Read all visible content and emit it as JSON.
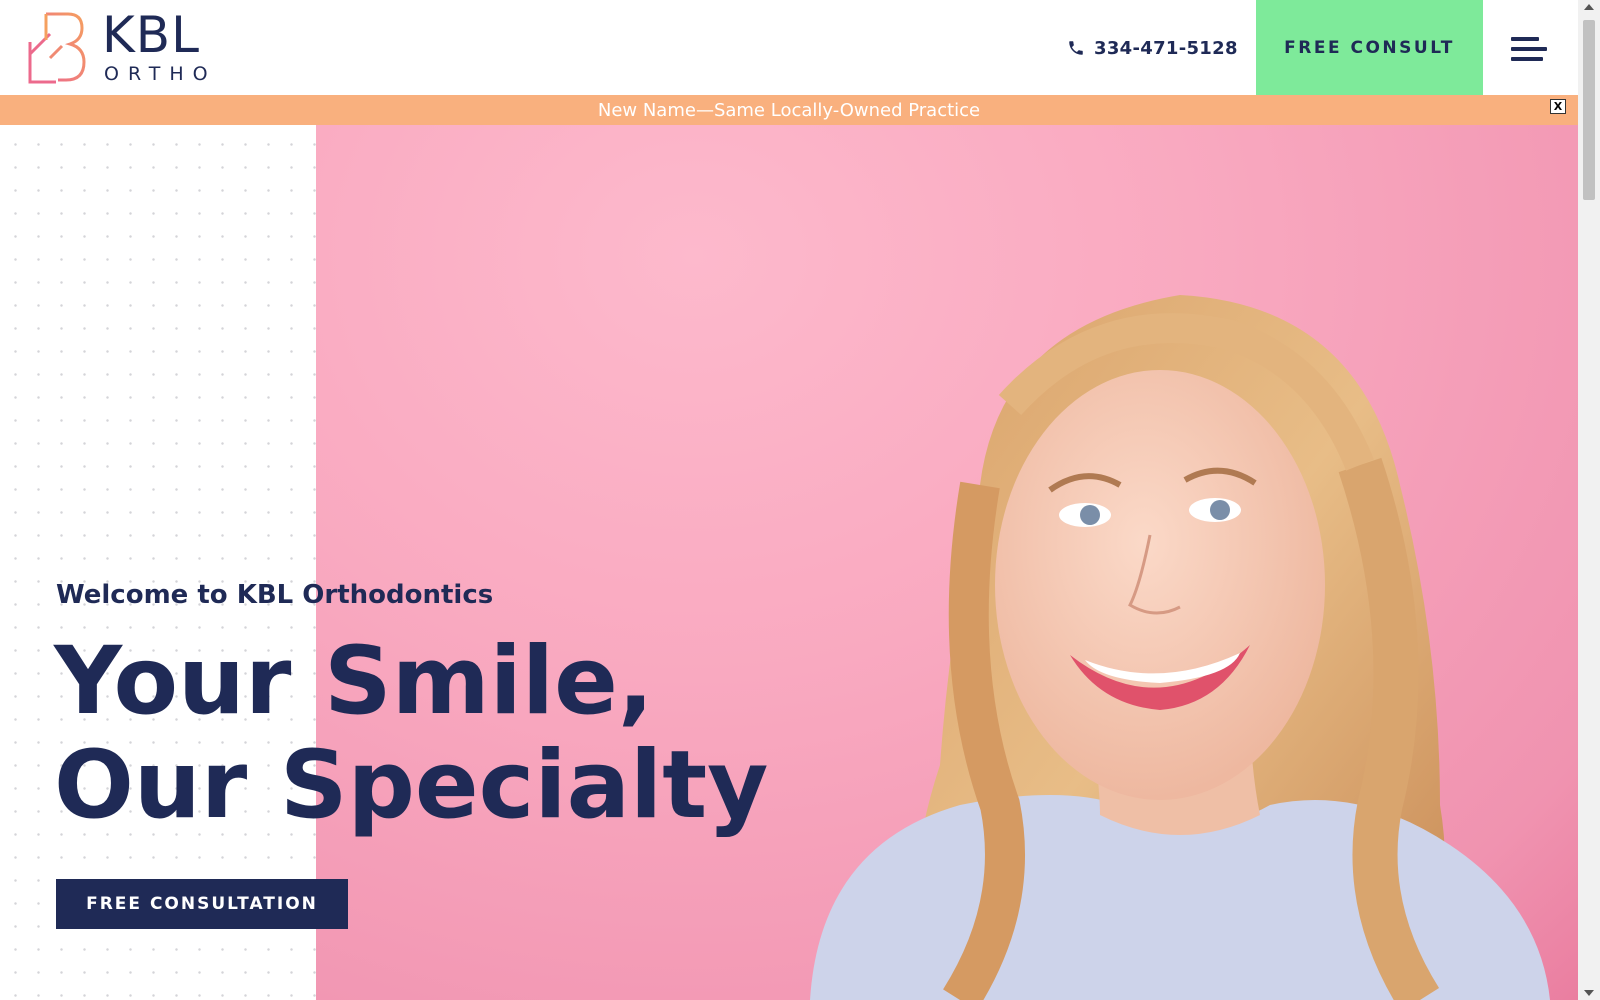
{
  "header": {
    "logo": {
      "brand": "KBL",
      "sub": "ORTHO"
    },
    "phone": {
      "icon": "phone-icon",
      "number": "334-471-5128"
    },
    "consult_button": "FREE CONSULT",
    "menu_icon": "hamburger-menu-icon"
  },
  "banner": {
    "text": "New Name—Same Locally-Owned Practice",
    "close_label": "X"
  },
  "hero": {
    "welcome": "Welcome to KBL Orthodontics",
    "headline_line1": "Your Smile,",
    "headline_line2": "Our Specialty",
    "cta_label": "FREE CONSULTATION"
  },
  "colors": {
    "navy": "#1f2a56",
    "consult_green": "#7eea9a",
    "banner_orange": "#f9b07e",
    "hero_pink": "#f9a9c0",
    "logo_pink": "#ec6a8c",
    "logo_orange": "#f5a05f"
  }
}
